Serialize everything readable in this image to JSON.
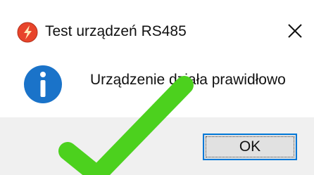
{
  "window": {
    "title": "Test urządzeń RS485",
    "app_icon": "red-lightning-icon",
    "close_icon": "close-icon"
  },
  "content": {
    "icon": "info-icon",
    "message": "Urządzenie działa prawidłowo"
  },
  "footer": {
    "ok_label": "OK"
  },
  "overlay": {
    "icon": "checkmark-icon",
    "color": "#4cd11e"
  },
  "colors": {
    "info_blue": "#1a73c9",
    "app_icon_red": "#e8442a",
    "focus_border": "#0078d7",
    "footer_bg": "#f0f0f0"
  }
}
